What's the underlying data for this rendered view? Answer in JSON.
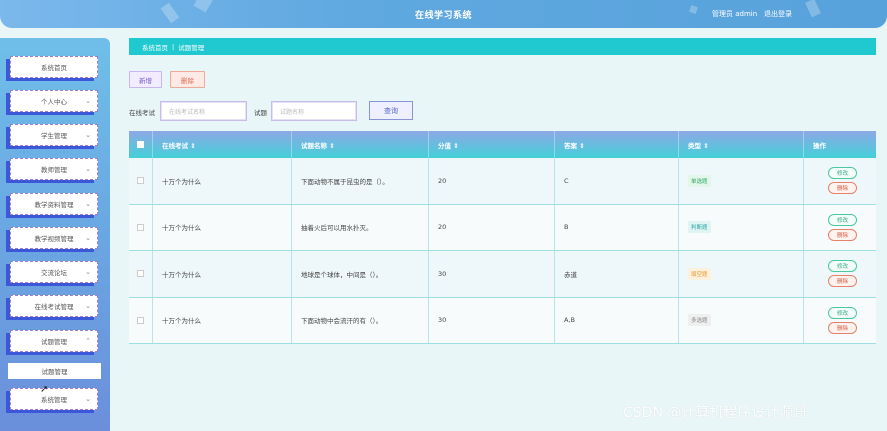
{
  "header": {
    "title": "在线学习系统",
    "user": "管理员 admin",
    "logout": "退出登录"
  },
  "sidebar": {
    "items": [
      {
        "label": "系统首页",
        "chevron": ""
      },
      {
        "label": "个人中心",
        "chevron": "⌄"
      },
      {
        "label": "学生管理",
        "chevron": "⌄"
      },
      {
        "label": "教师管理",
        "chevron": "⌄"
      },
      {
        "label": "教学资料管理",
        "chevron": "⌄"
      },
      {
        "label": "教学视频管理",
        "chevron": "⌄"
      },
      {
        "label": "交流论坛",
        "chevron": "⌄"
      },
      {
        "label": "在线考试管理",
        "chevron": "⌄"
      },
      {
        "label": "试题管理",
        "chevron": "⌃"
      },
      {
        "label": "系统管理",
        "chevron": "⌄"
      }
    ],
    "submenu": "试题管理"
  },
  "breadcrumb": {
    "home": "系统首页",
    "sep": "|",
    "current": "试题管理"
  },
  "toolbar": {
    "add": "新增",
    "delete": "删除"
  },
  "search": {
    "exam_label": "在线考试",
    "exam_placeholder": "在线考试名称",
    "question_label": "试题",
    "question_placeholder": "试题名称",
    "query": "查询"
  },
  "table": {
    "headers": [
      "在线考试 ⇕",
      "试题名称 ⇕",
      "分值 ⇕",
      "答案 ⇕",
      "类型 ⇕",
      "操作"
    ],
    "rows": [
      {
        "exam": "十万个为什么",
        "question": "下面动物不属于昆虫的是（）。",
        "score": "20",
        "answer": "C",
        "type": "单选题",
        "type_color": "#2ca86a",
        "type_bg": "#e3f6ea"
      },
      {
        "exam": "十万个为什么",
        "question": "抽着火后可以用水扑灭。",
        "score": "20",
        "answer": "B",
        "type": "判断题",
        "type_color": "#2aa3a6",
        "type_bg": "#e0f5f3"
      },
      {
        "exam": "十万个为什么",
        "question": "地球是个球体，中间是（）。",
        "score": "30",
        "answer": "赤道",
        "type": "填空题",
        "type_color": "#e39a2a",
        "type_bg": "#fdf0dc"
      },
      {
        "exam": "十万个为什么",
        "question": "下面动物中会流汗的有（）。",
        "score": "30",
        "answer": "A,B",
        "type": "多选题",
        "type_color": "#888888",
        "type_bg": "#efefef"
      }
    ],
    "edit": "修改",
    "delete": "删除"
  },
  "watermark": "CSDN @计算机程序设计源哥",
  "colors": {
    "accent": "#1fc9cf",
    "sidebar_shadow": "#3c57d8"
  }
}
